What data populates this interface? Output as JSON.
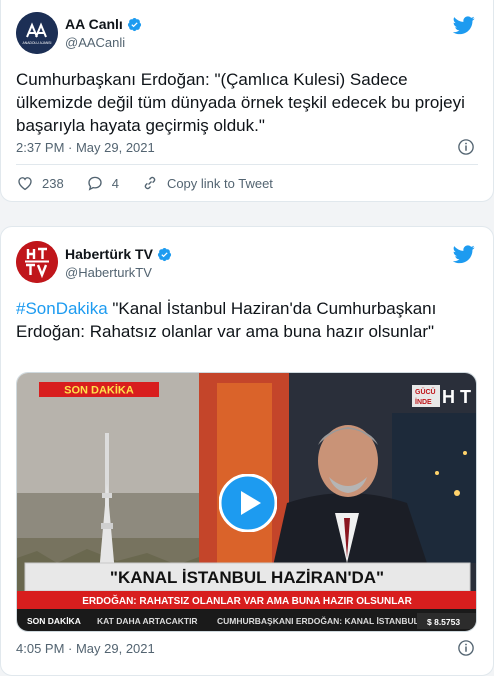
{
  "tweet1": {
    "display_name": "AA Canlı",
    "handle": "@AACanli",
    "avatar_text": "ANADOLU AJANSI",
    "text": "Cumhurbaşkanı Erdoğan: \"(Çamlıca Kulesi) Sadece ülkemizde değil tüm dünyada örnek teşkil edecek bu projeyi başarıyla hayata geçirmiş olduk.\"",
    "timestamp": "2:37 PM · May 29, 2021",
    "likes": "238",
    "replies": "4",
    "copy_link_label": "Copy link to Tweet"
  },
  "tweet2": {
    "display_name": "Habertürk TV",
    "handle": "@HaberturkTV",
    "hashtag": "#SonDakika",
    "text": " \"Kanal İstanbul Haziran'da Cumhurbaşkanı Erdoğan: Rahatsız olanlar var ama buna hazır olsunlar\"",
    "timestamp": "4:05 PM · May 29, 2021",
    "video": {
      "son_dakika_label": "SON DAKİKA",
      "corner_logo": "GÜCÜ",
      "corner_logo_2": "İNDE",
      "headline": "\"KANAL İSTANBUL HAZİRAN'DA\"",
      "subline": "ERDOĞAN: RAHATSIZ OLANLAR VAR AMA BUNA HAZIR OLSUNLAR",
      "ticker_label": "SON DAKİKA",
      "ticker_1": "KAT DAHA ARTACAKTIR",
      "ticker_2": "CUMHURBAŞKANI ERDOĞAN: KANAL İSTANBUL",
      "ticker_price": "$ 8.5753"
    }
  },
  "colors": {
    "accent": "#1d9bf0",
    "text_secondary": "#536471",
    "news_red": "#d81e1e"
  }
}
